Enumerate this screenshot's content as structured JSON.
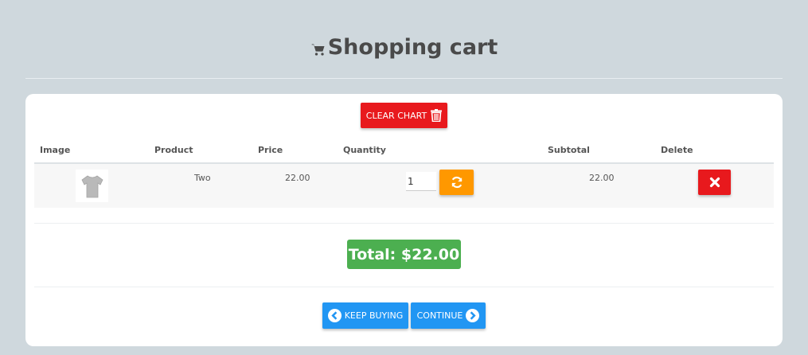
{
  "header": {
    "title": "Shopping cart",
    "icon": "cart-icon"
  },
  "actions": {
    "clear_label": "CLEAR CHART",
    "clear_icon": "trash-icon"
  },
  "table": {
    "columns": [
      "Image",
      "Product",
      "Price",
      "Quantity",
      "Subtotal",
      "Delete"
    ],
    "rows": [
      {
        "image": "t-shirt-icon",
        "product": "Two",
        "price": "22.00",
        "quantity": "1",
        "subtotal": "22.00"
      }
    ]
  },
  "summary": {
    "total_label": "Total: $22.00"
  },
  "nav": {
    "keep_buying_label": "KEEP BUYING",
    "continue_label": "CONTINUE"
  },
  "colors": {
    "background": "#cfd8dd",
    "danger": "#e8191d",
    "warning": "#ff9800",
    "success": "#4caf50",
    "primary": "#2196f3"
  }
}
